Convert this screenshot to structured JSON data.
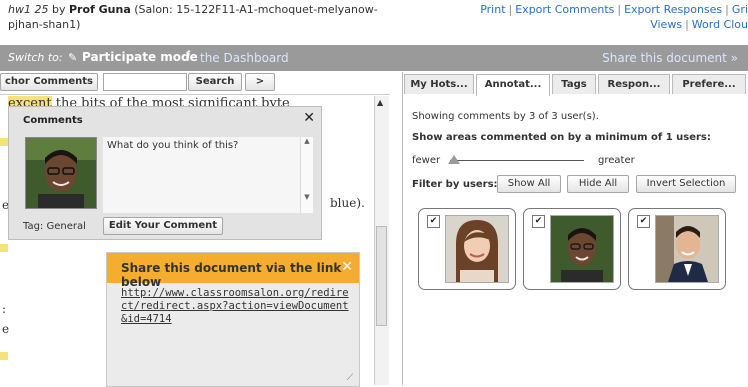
{
  "header": {
    "doc_name": "hw1 25",
    "by": "by",
    "owner": "Prof Guna",
    "salon": "(Salon: 15-122F11-A1-mchoquet-melyanow-",
    "salon_cont": "pjhan-shan1)",
    "links": [
      "Print",
      "Export Comments",
      "Export Responses",
      "Gri"
    ],
    "links_row2": [
      "Views",
      "Word Clou"
    ]
  },
  "toolbar": {
    "switch_to": "Switch to:",
    "mode": "Participate mode",
    "info": "i",
    "dashboard": "the Dashboard",
    "share": "Share this document »"
  },
  "search": {
    "anchor_label": "chor Comments",
    "search_label": "Search",
    "next_label": ">",
    "value": ""
  },
  "doc": {
    "line1_hl": "excent",
    "line1_rest": " the bits of the most significant byte",
    "frag_e1": "e",
    "frag_blue": "blue).",
    "frag_colon": ":",
    "frag_e2": "e"
  },
  "comments_popup": {
    "title": "Comments",
    "text": "What do you think of this?",
    "tag": "Tag: General",
    "edit_label": "Edit Your Comment"
  },
  "share_popup": {
    "title": "Share this document via the link below",
    "url": "http://www.classroomsalon.org/redirect/redirect.aspx?action=viewDocument&id=4714"
  },
  "right_panel": {
    "tabs": [
      "My Hots...",
      "Annotat...",
      "Tags",
      "Respon...",
      "Prefere..."
    ],
    "showing": "Showing comments by 3 of 3 user(s).",
    "areas": "Show areas commented on by a minimum of 1 users:",
    "fewer": "fewer",
    "greater": "greater",
    "slider_value": 1,
    "filter": "Filter by users:",
    "show_all": "Show All",
    "hide_all": "Hide All",
    "invert": "Invert Selection"
  },
  "colors": {
    "toolbar_bg": "#9a9a9a",
    "share_head": "#f4ad2f",
    "highlight": "#f5e27a",
    "link": "#2a70c2"
  }
}
